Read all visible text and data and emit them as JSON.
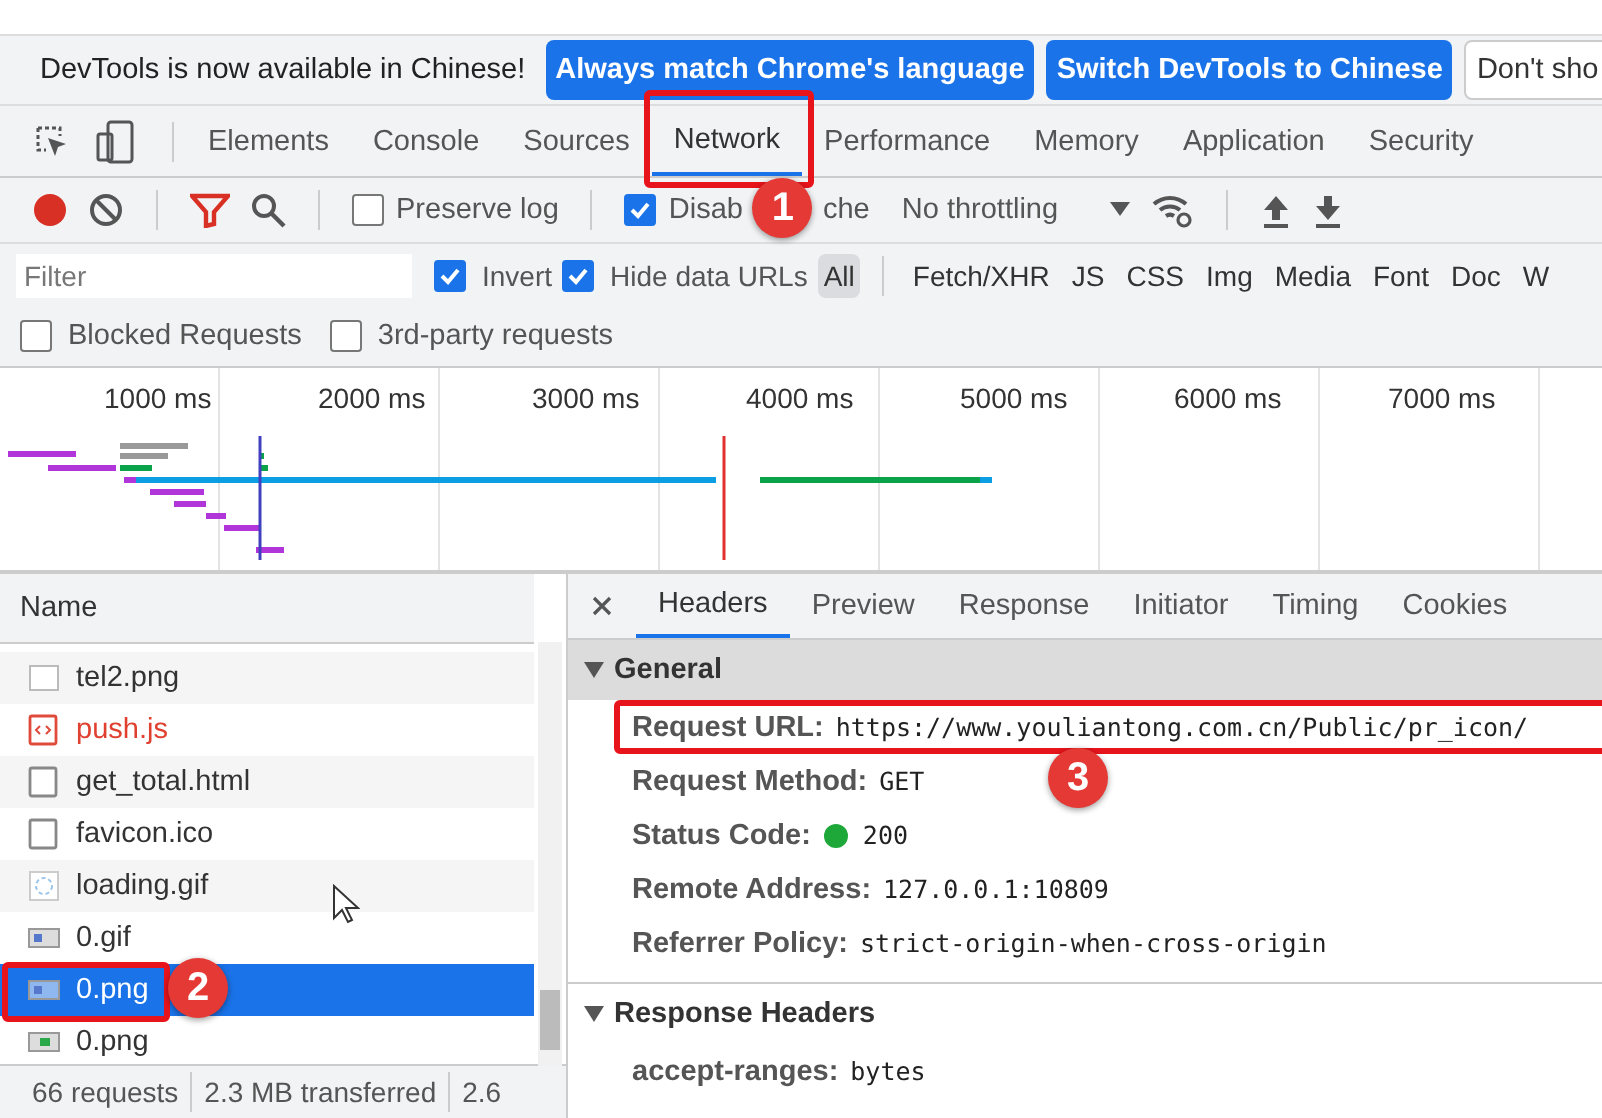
{
  "infobar": {
    "message": "DevTools is now available in Chinese!",
    "buttons": [
      "Always match Chrome's language",
      "Switch DevTools to Chinese",
      "Don't sho"
    ]
  },
  "tabs": [
    {
      "label": "Elements",
      "selected": false
    },
    {
      "label": "Console",
      "selected": false
    },
    {
      "label": "Sources",
      "selected": false
    },
    {
      "label": "Network",
      "selected": true,
      "callout": "1"
    },
    {
      "label": "Performance",
      "selected": false
    },
    {
      "label": "Memory",
      "selected": false
    },
    {
      "label": "Application",
      "selected": false
    },
    {
      "label": "Security",
      "selected": false
    }
  ],
  "toolbar": {
    "preserve_log": {
      "label": "Preserve log",
      "checked": false
    },
    "disable_cache": {
      "label_parts": [
        "Disab",
        "che"
      ],
      "checked": true
    },
    "throttling": "No throttling"
  },
  "filter_bar": {
    "placeholder": "Filter",
    "invert": {
      "label": "Invert",
      "checked": true
    },
    "hide_data_urls": {
      "label": "Hide data URLs",
      "checked": true
    },
    "types": [
      {
        "label": "All",
        "selected": true
      },
      {
        "label": "Fetch/XHR",
        "selected": false
      },
      {
        "label": "JS",
        "selected": false
      },
      {
        "label": "CSS",
        "selected": false
      },
      {
        "label": "Img",
        "selected": false
      },
      {
        "label": "Media",
        "selected": false
      },
      {
        "label": "Font",
        "selected": false
      },
      {
        "label": "Doc",
        "selected": false
      },
      {
        "label": "W",
        "selected": false
      }
    ]
  },
  "extra_filters": [
    {
      "label": "Blocked Requests",
      "checked": false
    },
    {
      "label": "3rd-party requests",
      "checked": false
    }
  ],
  "timeline": {
    "ticks": [
      "1000 ms",
      "2000 ms",
      "3000 ms",
      "4000 ms",
      "5000 ms",
      "6000 ms",
      "7000 ms"
    ]
  },
  "requests": {
    "column": "Name",
    "rows": [
      {
        "name": "tel2.png",
        "kind": "image",
        "failed": false,
        "selected": false
      },
      {
        "name": "push.js",
        "kind": "script",
        "failed": true,
        "selected": false
      },
      {
        "name": "get_total.html",
        "kind": "document",
        "failed": false,
        "selected": false
      },
      {
        "name": "favicon.ico",
        "kind": "document",
        "failed": false,
        "selected": false
      },
      {
        "name": "loading.gif",
        "kind": "spinner",
        "failed": false,
        "selected": false
      },
      {
        "name": "0.gif",
        "kind": "picture",
        "failed": false,
        "selected": false
      },
      {
        "name": "0.png",
        "kind": "picture",
        "failed": false,
        "selected": true,
        "callout": "2"
      },
      {
        "name": "0.png",
        "kind": "picture-green",
        "failed": false,
        "selected": false
      }
    ]
  },
  "status_bar": [
    "66 requests",
    "2.3 MB transferred",
    "2.6"
  ],
  "detail_tabs": [
    {
      "label": "Headers",
      "selected": true
    },
    {
      "label": "Preview",
      "selected": false
    },
    {
      "label": "Response",
      "selected": false
    },
    {
      "label": "Initiator",
      "selected": false
    },
    {
      "label": "Timing",
      "selected": false
    },
    {
      "label": "Cookies",
      "selected": false
    }
  ],
  "sections": [
    {
      "title": "General",
      "expanded": true,
      "fields": [
        {
          "label": "Request URL:",
          "value": "https://www.youliantong.com.cn/Public/pr_icon/",
          "kind": "text",
          "callout": "3"
        },
        {
          "label": "Request Method:",
          "value": "GET",
          "kind": "text"
        },
        {
          "label": "Status Code:",
          "value": "200",
          "kind": "status"
        },
        {
          "label": "Remote Address:",
          "value": "127.0.0.1:10809",
          "kind": "text"
        },
        {
          "label": "Referrer Policy:",
          "value": "strict-origin-when-cross-origin",
          "kind": "text"
        }
      ]
    },
    {
      "title": "Response Headers",
      "expanded": true,
      "fields": [
        {
          "label": "accept-ranges:",
          "value": "bytes",
          "kind": "text"
        }
      ]
    }
  ]
}
